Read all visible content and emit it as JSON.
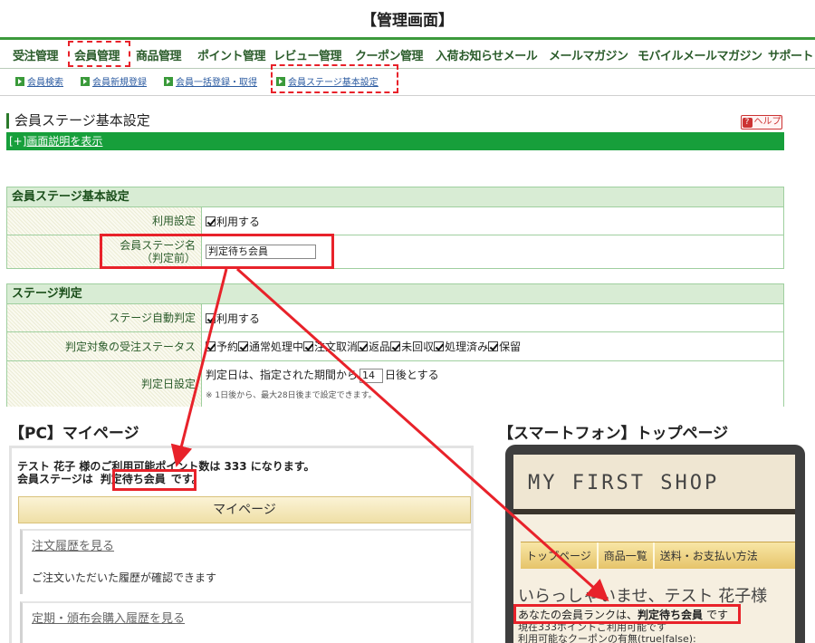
{
  "title": "【管理画面】",
  "topnav": {
    "items": [
      "受注管理",
      "会員管理",
      "商品管理",
      "ポイント管理",
      "レビュー管理",
      "クーポン管理",
      "入荷お知らせメール",
      "メールマガジン",
      "モバイルメールマガジン",
      "サポート"
    ],
    "active": "会員管理"
  },
  "subnav": {
    "items": [
      "会員検索",
      "会員新規登録",
      "会員一括登録・取得",
      "会員ステージ基本設定"
    ],
    "active": "会員ステージ基本設定"
  },
  "section": {
    "title": "会員ステージ基本設定",
    "help_label": "ヘルプ",
    "help_q": "?",
    "toggle_label": "[+]",
    "toggle_link": "画面説明を表示"
  },
  "basic": {
    "header": "会員ステージ基本設定",
    "use_label": "利用設定",
    "use_check": "利用する",
    "name_label_1": "会員ステージ名",
    "name_label_2": "（判定前）",
    "name_value": "判定待ち会員"
  },
  "stage": {
    "header": "ステージ判定",
    "auto_label": "ステージ自動判定",
    "auto_check": "利用する",
    "status_label": "判定対象の受注ステータス",
    "statuses": [
      "予約",
      "通常処理中",
      "注文取消",
      "返品",
      "未回収",
      "処理済み",
      "保留"
    ],
    "date_label": "判定日設定",
    "date_prefix": "判定日は、指定された期間から",
    "date_value": "14",
    "date_suffix": "日後とする",
    "date_note": "※ 1日後から、最大28日後まで設定できます。"
  },
  "pc": {
    "caption": "【PC】マイページ",
    "msg_line1": "テスト 花子 様のご利用可能ポイント数は 333 になります。",
    "msg_line2_pre": "会員ステージは",
    "msg_stage": "判定待ち会員",
    "msg_line2_post": "です。",
    "mypage_header": "マイページ",
    "link1": "注文履歴を見る",
    "desc1": "ご注文いただいた履歴が確認できます",
    "link2": "定期・頒布会購入履歴を見る"
  },
  "sp": {
    "caption": "【スマートフォン】トップページ",
    "logo": "MY FIRST SHOP",
    "nav": [
      "トップページ",
      "商品一覧",
      "送料・お支払い方法"
    ],
    "welcome": "いらっしゃいませ、テスト 花子様",
    "rank_pre": "あなたの会員ランクは、",
    "rank_value": "判定待ち会員",
    "rank_post": "です",
    "line2": "現在333ポイントご利用可能です",
    "line3": "利用可能なクーポンの有無(true|false):"
  },
  "colors": {
    "accent_red": "#e8222a",
    "admin_green": "#179f3b",
    "nav_green": "#3c9a3c"
  }
}
